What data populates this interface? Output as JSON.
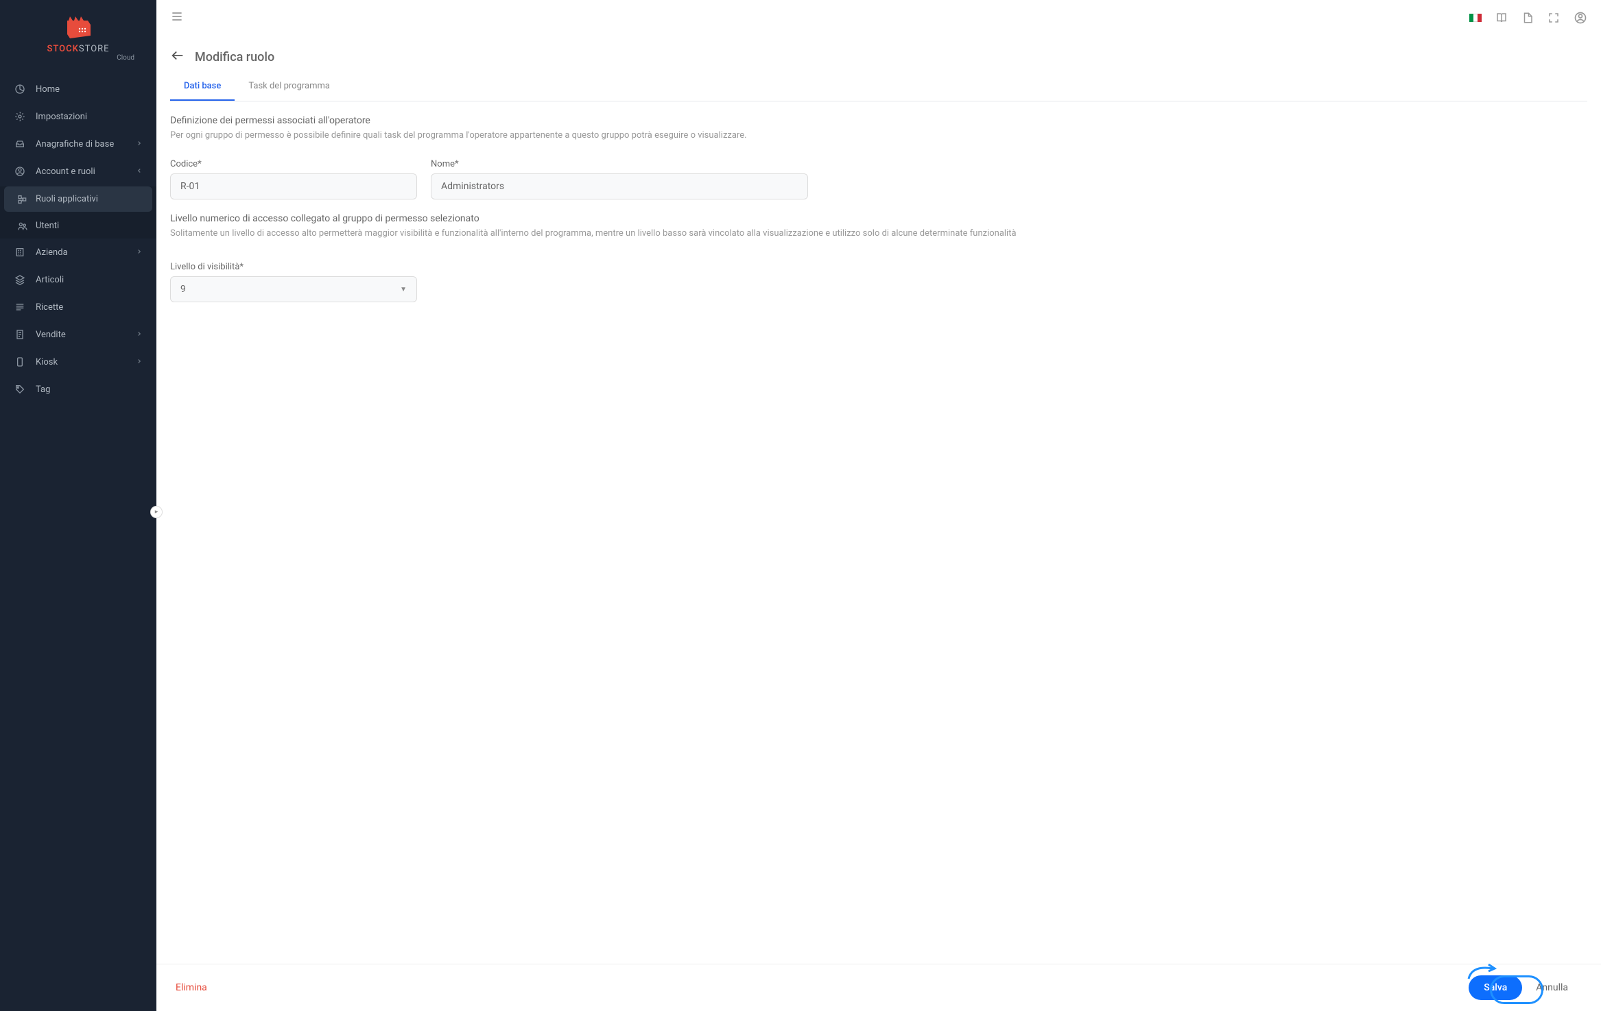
{
  "logo": {
    "brand_left": "STOCK",
    "brand_right": "STORE",
    "sub": "Cloud"
  },
  "sidebar": {
    "items": [
      {
        "label": "Home"
      },
      {
        "label": "Impostazioni"
      },
      {
        "label": "Anagrafiche di base"
      },
      {
        "label": "Account e ruoli"
      },
      {
        "label": "Azienda"
      },
      {
        "label": "Articoli"
      },
      {
        "label": "Ricette"
      },
      {
        "label": "Vendite"
      },
      {
        "label": "Kiosk"
      },
      {
        "label": "Tag"
      }
    ],
    "subitems": [
      {
        "label": "Ruoli applicativi"
      },
      {
        "label": "Utenti"
      }
    ]
  },
  "page": {
    "title": "Modifica ruolo"
  },
  "tabs": [
    {
      "label": "Dati base"
    },
    {
      "label": "Task del programma"
    }
  ],
  "section1": {
    "title": "Definizione dei permessi associati all'operatore",
    "desc": "Per ogni gruppo di permesso è possibile definire quali task del programma l'operatore appartenente a questo gruppo potrà eseguire o visualizzare."
  },
  "form": {
    "codice_label": "Codice*",
    "codice_value": "R-01",
    "nome_label": "Nome*",
    "nome_value": "Administrators",
    "visibilita_label": "Livello di visibilità*",
    "visibilita_value": "9"
  },
  "section2": {
    "title": "Livello numerico di accesso collegato al gruppo di permesso selezionato",
    "desc": "Solitamente un livello di accesso alto permetterà maggior visibilità e funzionalità all'interno del programma, mentre un livello basso sarà vincolato alla visualizzazione e utilizzo solo di alcune determinate funzionalità"
  },
  "footer": {
    "delete": "Elimina",
    "save": "Salva",
    "cancel": "Annulla"
  }
}
